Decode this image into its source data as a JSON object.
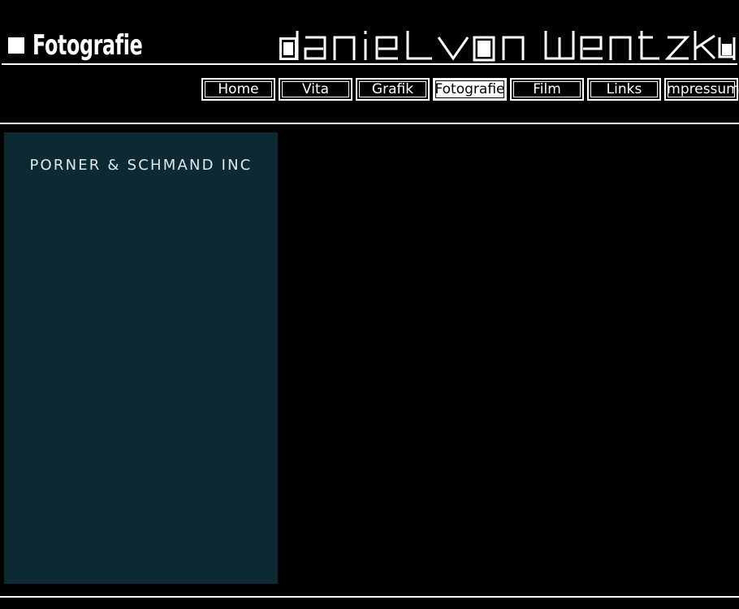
{
  "header": {
    "section_title": "Fotografie",
    "logo_text": "danieL von wentzky"
  },
  "nav": {
    "items": [
      {
        "label": "Home",
        "active": false
      },
      {
        "label": "Vita",
        "active": false
      },
      {
        "label": "Grafik",
        "active": false
      },
      {
        "label": "Fotografie",
        "active": true
      },
      {
        "label": "Film",
        "active": false
      },
      {
        "label": "Links",
        "active": false
      },
      {
        "label": "Impressum",
        "active": false
      }
    ]
  },
  "photo": {
    "brand_text": "PORNER & SCHMAND INC"
  },
  "colors": {
    "background": "#000000",
    "foreground": "#ffffff",
    "photo_background": "#0b2a33"
  }
}
